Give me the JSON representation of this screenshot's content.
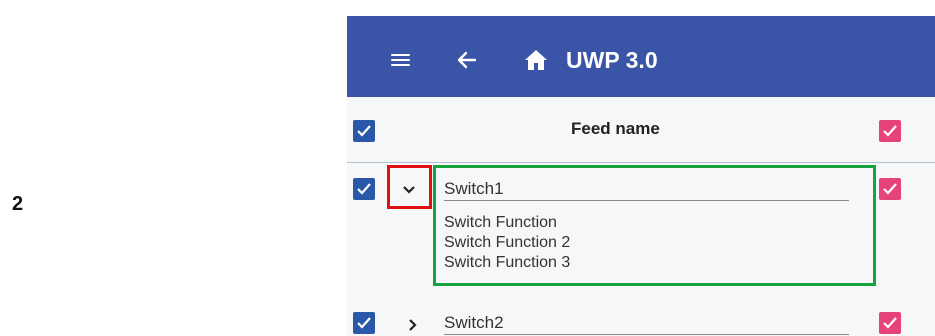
{
  "step_label": "2",
  "app_bar": {
    "title": "UWP 3.0",
    "icons": [
      "menu-icon",
      "back-arrow-icon",
      "home-icon"
    ],
    "color": "#3a55a8"
  },
  "table": {
    "header": {
      "feed_name_label": "Feed name"
    },
    "rows": [
      {
        "name": "Switch1",
        "expanded": true,
        "selected": true,
        "functions": [
          "Switch Function",
          "Switch Function 2",
          "Switch Function 3"
        ]
      },
      {
        "name": "Switch2",
        "expanded": false,
        "selected": true,
        "functions": []
      }
    ]
  },
  "colors": {
    "checkbox_blue": "#2a58a8",
    "checkbox_pink": "#e6437a",
    "highlight_red": "#e01010",
    "highlight_green": "#17a33d"
  }
}
